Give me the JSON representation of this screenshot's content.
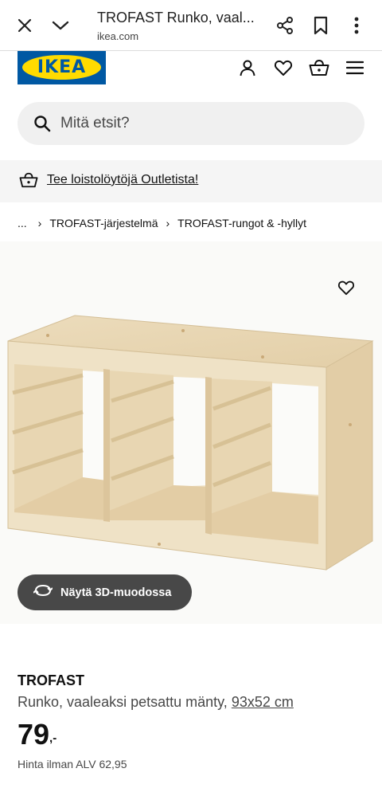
{
  "browser": {
    "title": "TROFAST Runko, vaal...",
    "domain": "ikea.com",
    "icons": [
      "close-icon",
      "chevron-down-icon",
      "share-icon",
      "bookmark-icon",
      "more-vert-icon"
    ]
  },
  "header": {
    "logo_text": "IKEA",
    "icons": [
      "account-icon",
      "heart-icon",
      "shopping-bag-icon",
      "menu-icon"
    ]
  },
  "search": {
    "placeholder": "Mitä etsit?"
  },
  "banner": {
    "link_text": "Tee loistolöytöjä Outletista!"
  },
  "breadcrumb": {
    "ellipsis": "...",
    "items": [
      "TROFAST-järjestelmä",
      "TROFAST-rungot & -hyllyt"
    ]
  },
  "gallery": {
    "view3d_label": "Näytä 3D-muodossa"
  },
  "product": {
    "name": "TROFAST",
    "description": "Runko, vaaleaksi petsattu mänty,",
    "size_link": "93x52 cm",
    "price_main": "79",
    "price_suffix": ",-",
    "vat_text": "Hinta ilman ALV 62,95"
  },
  "colors": {
    "ikea_blue": "#0058a3",
    "ikea_yellow": "#ffdb00",
    "pill_dark": "#484848"
  }
}
